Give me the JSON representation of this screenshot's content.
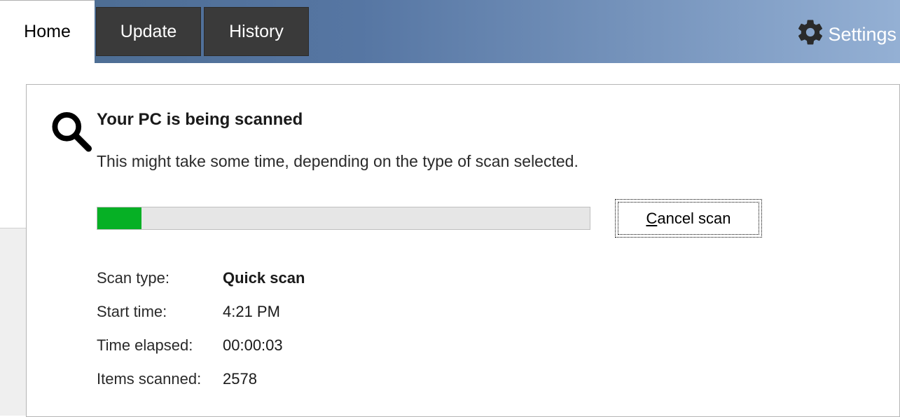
{
  "tabs": {
    "home": "Home",
    "update": "Update",
    "history": "History"
  },
  "settings_label": "Settings",
  "scan": {
    "title": "Your PC is being scanned",
    "subtitle": "This might take some time, depending on the type of scan selected.",
    "progress_percent": 9,
    "cancel_label_rest": "ancel scan",
    "cancel_label_first": "C"
  },
  "details": {
    "scan_type_label": "Scan type:",
    "scan_type_value": "Quick scan",
    "start_time_label": "Start time:",
    "start_time_value": "4:21 PM",
    "time_elapsed_label": "Time elapsed:",
    "time_elapsed_value": "00:00:03",
    "items_scanned_label": "Items scanned:",
    "items_scanned_value": "2578"
  }
}
